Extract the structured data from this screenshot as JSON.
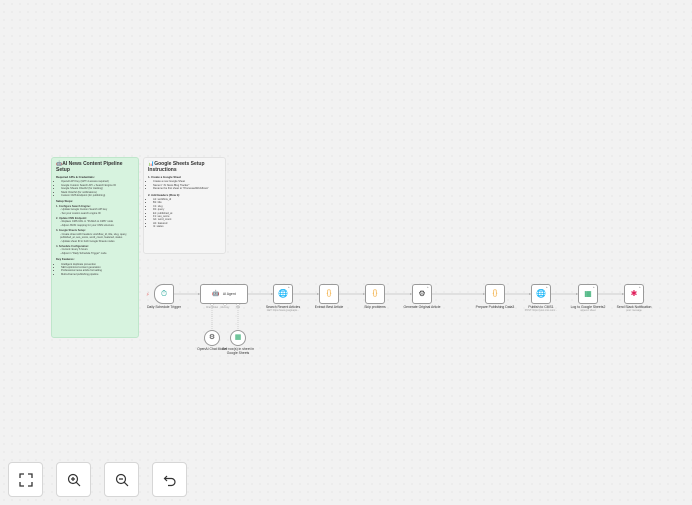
{
  "notes": {
    "setup": {
      "title": "🤖AI News Content Pipeline Setup",
      "required_heading": "Required APIs & Credentials:",
      "required_items": [
        "OpenAI API Key (GPT-4 access required)",
        "Google Custom Search API + Search Engine ID",
        "Google Sheets OAuth2 (for tracking)",
        "Slack OAuth2 (for notifications)",
        "Custom CMS Endpoint (for publishing)"
      ],
      "steps_heading": "Setup Steps:",
      "steps": [
        {
          "title": "1. Configure Search Engine:",
          "sub": [
            "- Update Google Custom Search API key",
            "- Set your custom search engine ID"
          ]
        },
        {
          "title": "2. Update CMS Endpoint:",
          "sub": [
            "- Replace CMS URL in \"Publish to CMS\" node",
            "- Adjust JSON mapping for your CMS structure"
          ]
        },
        {
          "title": "3. Google Sheets Setup:",
          "sub": [
            "- Create sheet with headers: workflow_id, title, slug, query, published_at, seo_score, word_count, featured, status",
            "- Update sheet ID in both Google Sheets nodes"
          ]
        },
        {
          "title": "4. Schedule Configuration:",
          "sub": [
            "- Current: Every 6 hours",
            "- Adjust in \"Daily Schedule Trigger\" node"
          ]
        }
      ],
      "features_heading": "Key Features:",
      "features": [
        "Intelligent duplicate prevention",
        "SEO-optimized content generation",
        "Professional news article formatting",
        "Multi-channel publishing pipeline"
      ]
    },
    "sheets": {
      "title": "📊Google Sheets Setup Instructions",
      "step1_heading": "1. Create a Google Sheet",
      "step1_items": [
        "Create a new Google Sheet",
        "Name it \"AI News Blog Tracker\"",
        "Rename the first sheet to \"ProcessedWorkflows\""
      ],
      "step2_heading": "2. Add Headers (Row 1):",
      "headers": [
        "A1: workflow_id",
        "B1: title",
        "C1: slug",
        "D1: query",
        "E1: published_at",
        "F1: seo_score",
        "G1: word_count",
        "H1: featured",
        "I1: status"
      ]
    }
  },
  "nodes": [
    {
      "id": "trigger",
      "label": "Daily Schedule Trigger",
      "sublabel": "",
      "icon": "clock-icon",
      "glyph": "⏱",
      "color": "#26a69a"
    },
    {
      "id": "agent",
      "label": "",
      "agent_label": "AI Agent",
      "sublabel": "",
      "icon": "robot-icon",
      "glyph": "🤖",
      "color": "#555555"
    },
    {
      "id": "search",
      "label": "Search Recent Articles",
      "sublabel": "GET: https://www.googleapis...",
      "icon": "globe-icon",
      "glyph": "🌐",
      "color": "#3b7dd8"
    },
    {
      "id": "extract",
      "label": "Extract Best Article",
      "sublabel": "",
      "icon": "code-icon",
      "glyph": "{}",
      "color": "#f0a020"
    },
    {
      "id": "skip",
      "label": "Skip problems",
      "sublabel": "",
      "icon": "code-icon",
      "glyph": "{}",
      "color": "#f0a020"
    },
    {
      "id": "generate",
      "label": "Generate Original Article",
      "sublabel": "",
      "icon": "openai-icon",
      "glyph": "⚙",
      "color": "#333333"
    },
    {
      "id": "prepare",
      "label": "Prepare Publishing Data3",
      "sublabel": "",
      "icon": "code-icon",
      "glyph": "{}",
      "color": "#f0a020"
    },
    {
      "id": "publish",
      "label": "Publish to CMS1",
      "sublabel": "POST: https://your-cms.com/...",
      "icon": "globe-icon",
      "glyph": "🌐",
      "color": "#3b7dd8"
    },
    {
      "id": "log",
      "label": "Log to Google Sheets2",
      "sublabel": "append: sheet",
      "icon": "sheets-icon",
      "glyph": "▦",
      "color": "#1fa463"
    },
    {
      "id": "slack",
      "label": "Send Slack Notification",
      "sublabel": "post: message",
      "icon": "slack-icon",
      "glyph": "✱",
      "color": "#e01e5a"
    }
  ],
  "sub_nodes": [
    {
      "id": "chat",
      "label": "OpenAI Chat Model",
      "sublabel": "",
      "icon": "openai-icon",
      "glyph": "⚙",
      "color": "#333333"
    },
    {
      "id": "tool",
      "label": "Get row(s) in sheet in Google Sheets",
      "sublabel": "",
      "icon": "sheets-icon",
      "glyph": "▦",
      "color": "#1fa463"
    }
  ],
  "agent_ports": [
    "Chat Model",
    "Memory",
    "Tool"
  ],
  "controls": [
    {
      "id": "fit",
      "icon": "fit-view-icon",
      "glyph": "⛶"
    },
    {
      "id": "zoomin",
      "icon": "zoom-in-icon",
      "glyph": "⊕"
    },
    {
      "id": "zoomout",
      "icon": "zoom-out-icon",
      "glyph": "⊖"
    },
    {
      "id": "undo",
      "icon": "undo-icon",
      "glyph": "↶"
    }
  ]
}
